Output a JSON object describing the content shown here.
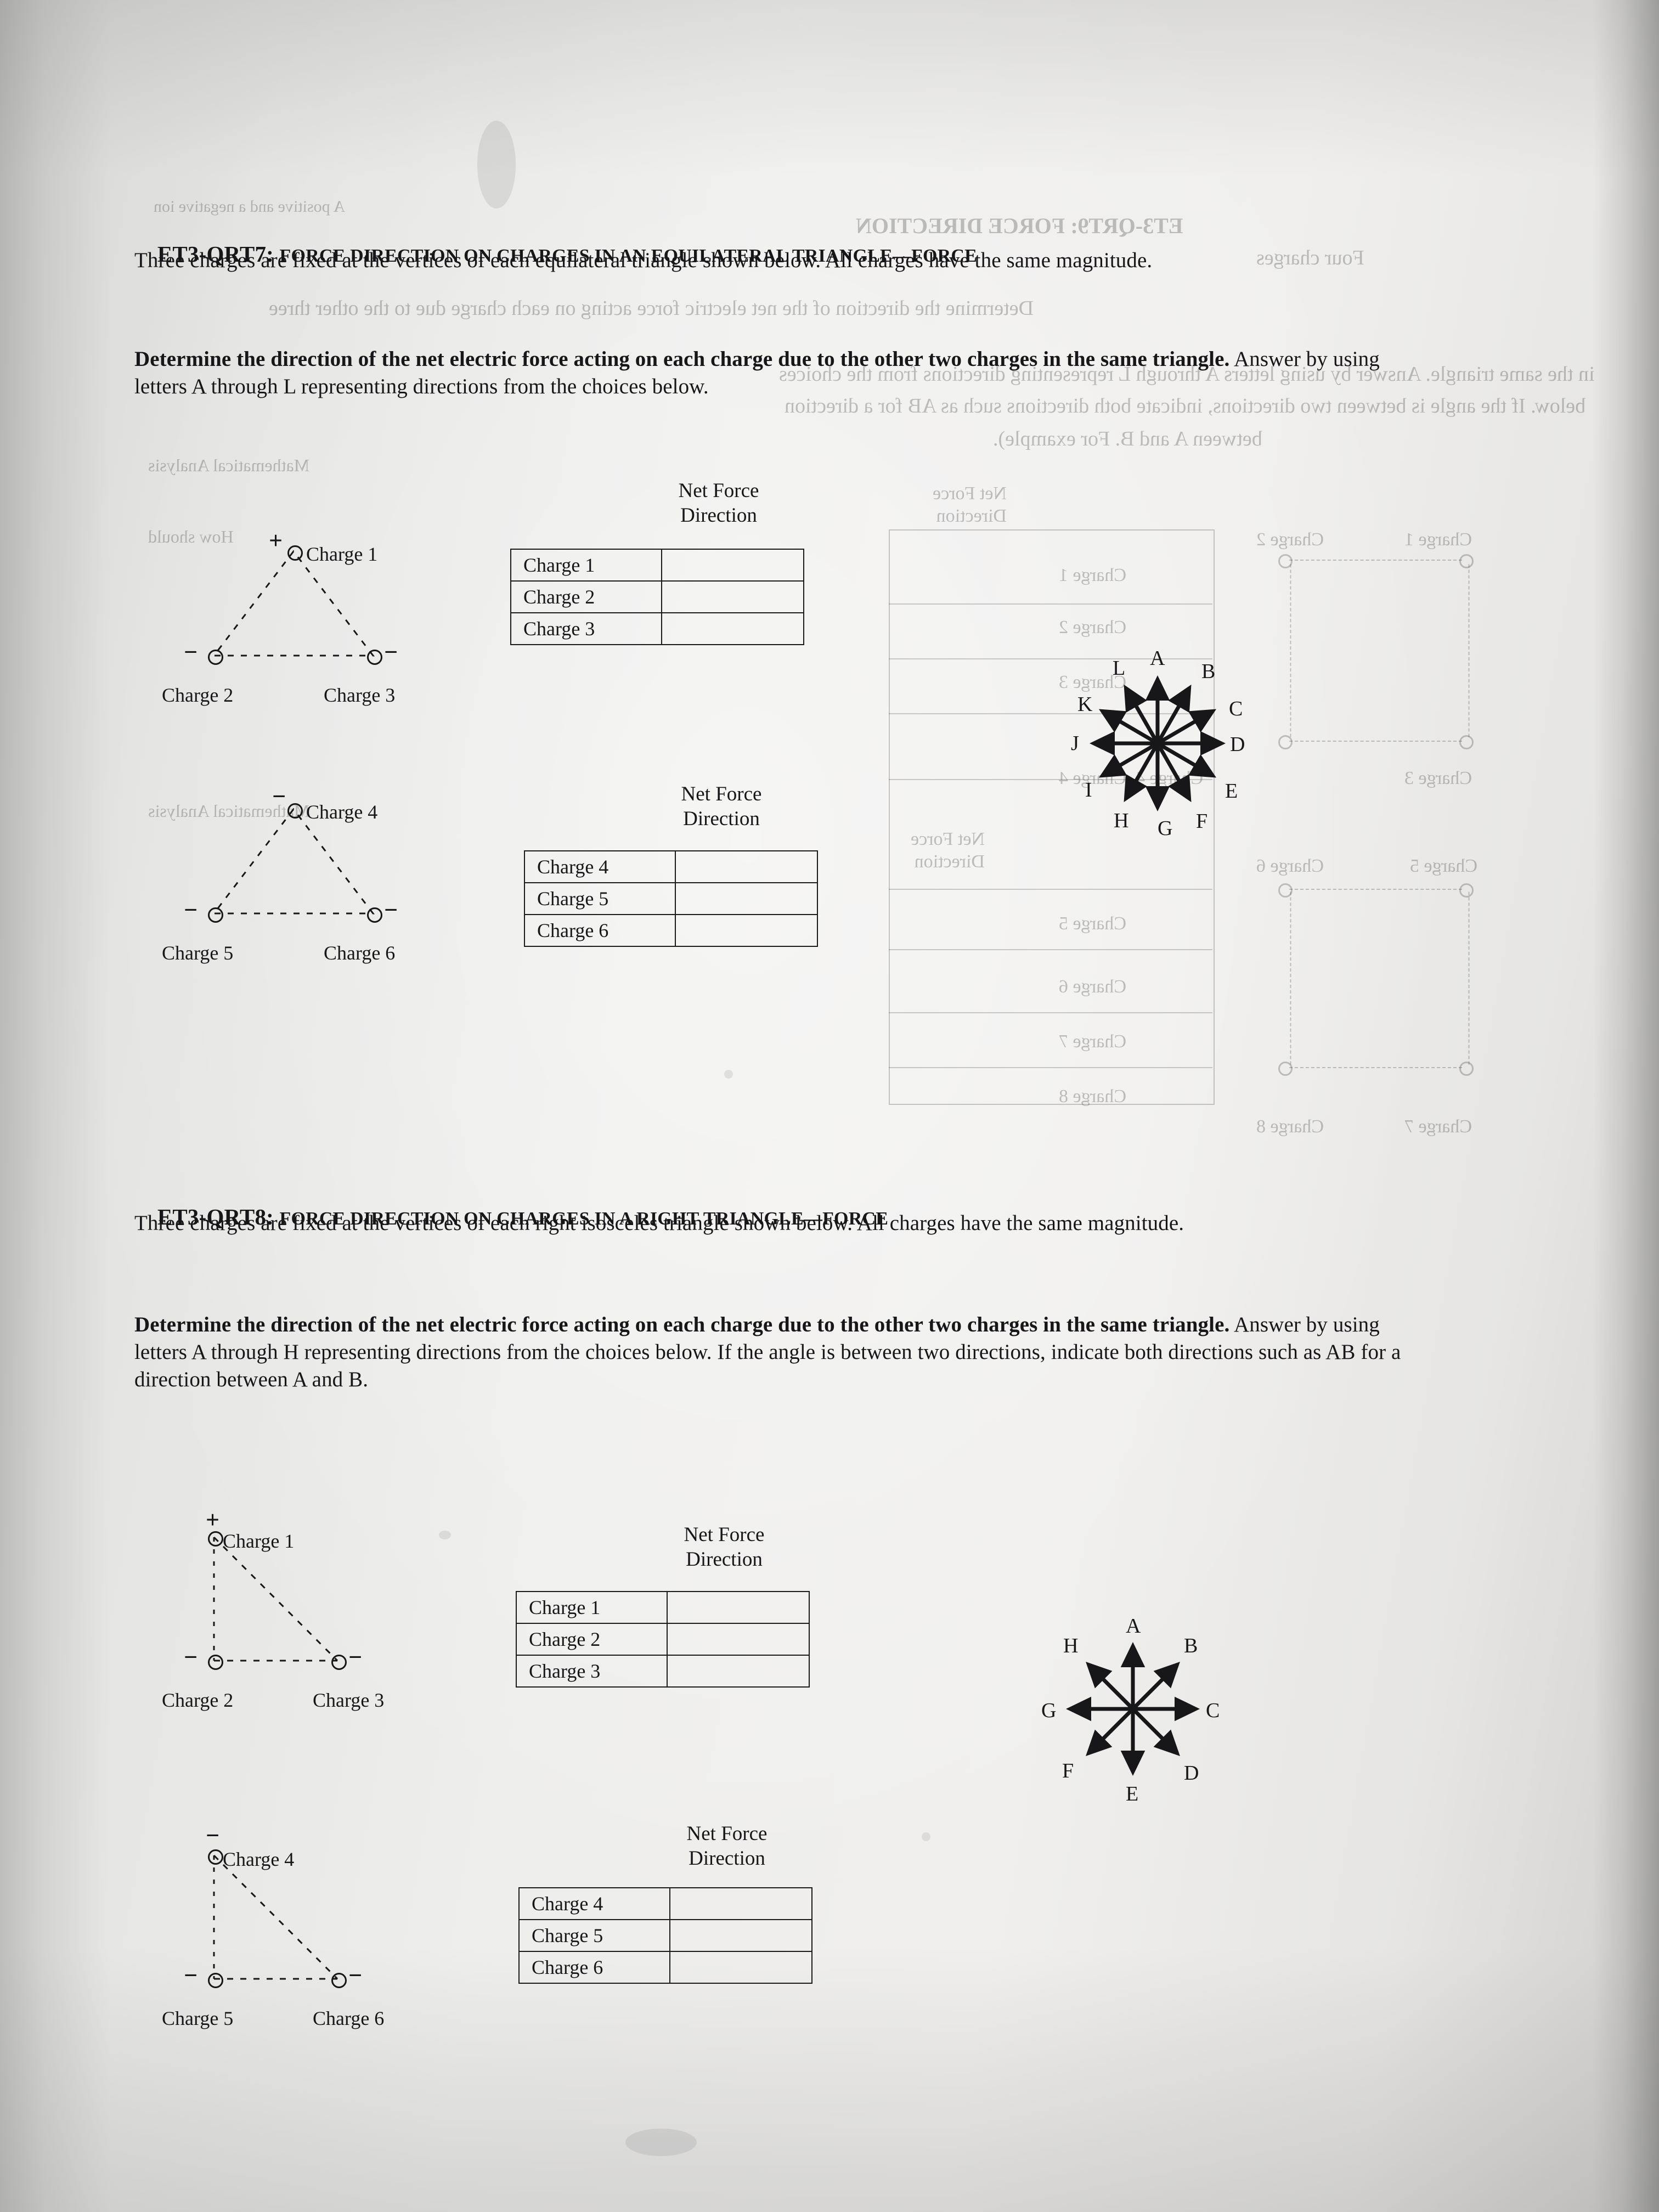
{
  "page": {
    "background_color": "#ececea",
    "text_color": "#17171a"
  },
  "qrt7": {
    "id": "ET3-QRT7:",
    "title": "FORCE DIRECTION ON CHARGES IN AN EQUILATERAL TRIANGLE—FORCE",
    "intro": "Three charges are fixed at the vertices of each equilateral triangle shown below. All charges have the same magnitude.",
    "instruction_bold": "Determine the direction of the net electric force acting on each charge due to the other two charges in the same triangle.",
    "instruction_rest": " Answer by using letters A through L representing directions from the choices below.",
    "table1": {
      "header": "Net Force\nDirection",
      "rows": [
        {
          "label": "Charge 1",
          "value": ""
        },
        {
          "label": "Charge 2",
          "value": ""
        },
        {
          "label": "Charge 3",
          "value": ""
        }
      ]
    },
    "table2": {
      "header": "Net Force\nDirection",
      "rows": [
        {
          "label": "Charge 4",
          "value": ""
        },
        {
          "label": "Charge 5",
          "value": ""
        },
        {
          "label": "Charge 6",
          "value": ""
        }
      ]
    },
    "triangle1": {
      "apex": {
        "label": "Charge 1",
        "sign": "+"
      },
      "left": {
        "label": "Charge 2",
        "sign": "−"
      },
      "right": {
        "label": "Charge 3",
        "sign": "−"
      }
    },
    "triangle2": {
      "apex": {
        "label": "Charge 4",
        "sign": "−"
      },
      "left": {
        "label": "Charge 5",
        "sign": "−"
      },
      "right": {
        "label": "Charge 6",
        "sign": "−"
      }
    },
    "direction_star": {
      "labels": [
        "A",
        "B",
        "C",
        "D",
        "E",
        "F",
        "G",
        "H",
        "I",
        "J",
        "K",
        "L"
      ],
      "count": 12
    }
  },
  "qrt8": {
    "id": "ET3-QRT8:",
    "title": "FORCE DIRECTION ON CHARGES IN A RIGHT TRIANGLE—FORCE",
    "intro": "Three charges are fixed at the vertices of each right isosceles triangle shown below. All charges have the same magnitude.",
    "instruction_bold": "Determine the direction of the net electric force acting on each charge due to the other two charges in the same triangle.",
    "instruction_rest": " Answer by using letters A through H representing directions from the choices below. If the angle is between two directions, indicate both directions such as AB for a direction between A and B.",
    "table1": {
      "header": "Net Force\nDirection",
      "rows": [
        {
          "label": "Charge 1",
          "value": ""
        },
        {
          "label": "Charge 2",
          "value": ""
        },
        {
          "label": "Charge 3",
          "value": ""
        }
      ]
    },
    "table2": {
      "header": "Net Force\nDirection",
      "rows": [
        {
          "label": "Charge 4",
          "value": ""
        },
        {
          "label": "Charge 5",
          "value": ""
        },
        {
          "label": "Charge 6",
          "value": ""
        }
      ]
    },
    "triangle1": {
      "apex": {
        "label": "Charge 1",
        "sign": "+"
      },
      "left": {
        "label": "Charge 2",
        "sign": "−"
      },
      "right": {
        "label": "Charge 3",
        "sign": "−"
      }
    },
    "triangle2": {
      "apex": {
        "label": "Charge 4",
        "sign": "−"
      },
      "left": {
        "label": "Charge 5",
        "sign": "−"
      },
      "right": {
        "label": "Charge 6",
        "sign": "−"
      }
    },
    "direction_star": {
      "labels": [
        "A",
        "B",
        "C",
        "D",
        "E",
        "F",
        "G",
        "H"
      ],
      "count": 8
    }
  },
  "bleed": {
    "heading": "ET3-QRT9: FORCE DIRECTION",
    "line1": "Four charges",
    "line2": "Determine the direction of the net electric force acting on each charge due to the other three",
    "line3": "in the same triangle. Answer by using letters A through L representing directions from the choices",
    "line4": "below. If the angle is between two directions, indicate both directions such as AB for a direction",
    "line5": "between A and B. For example).",
    "labels": [
      "Charge 1",
      "Charge 2",
      "Charge 3",
      "Charge 4",
      "Charge 5",
      "Charge 6",
      "Charge 7",
      "Charge 8"
    ],
    "table_header": "Net Force\nDirection"
  }
}
